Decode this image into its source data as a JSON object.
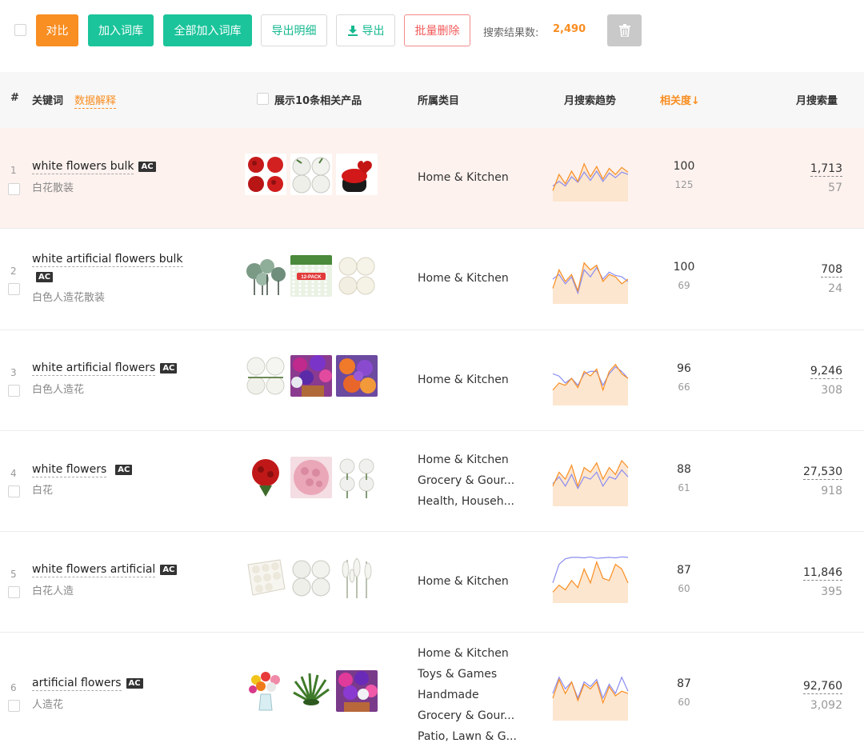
{
  "toolbar": {
    "compare_label": "对比",
    "add_to_lib_label": "加入词库",
    "add_all_to_lib_label": "全部加入词库",
    "export_detail_label": "导出明细",
    "export_label": "导出",
    "bulk_delete_label": "批量删除",
    "result_label": "搜索结果数:",
    "result_count": "2,490",
    "trash_icon": "trash-icon",
    "download_icon": "download-icon"
  },
  "header": {
    "index": "#",
    "keyword": "关键词",
    "data_explain": "数据解释",
    "show_products": "展示10条相关产品",
    "category": "所属类目",
    "trend": "月搜索趋势",
    "relevance": "相关度",
    "relevance_sort_icon": "arrow-down-icon",
    "volume": "月搜索量"
  },
  "colors": {
    "accent_orange": "#f98e22",
    "accent_green": "#1bc49b",
    "danger_red": "#f25a5a",
    "trend_orange": "#f98e22",
    "trend_blue": "#8a8cf0",
    "highlight_row": "#fdf2ee"
  },
  "rows": [
    {
      "index": "1",
      "keyword": "white flowers bulk",
      "badge": "AC",
      "translation": "白花散装",
      "categories": [
        "Home & Kitchen"
      ],
      "relevance": "100",
      "relevance_sub": "125",
      "volume": "1,713",
      "volume_sub": "57",
      "products": [
        "red-rose-bouquets-image",
        "white-rose-bouquets-image",
        "red-rose-heart-box-image"
      ],
      "trend_orange": [
        20,
        55,
        35,
        62,
        40,
        78,
        50,
        72,
        45,
        68,
        55,
        70,
        60
      ],
      "trend_blue": [
        30,
        40,
        30,
        50,
        38,
        60,
        42,
        62,
        40,
        58,
        48,
        60,
        55
      ]
    },
    {
      "index": "2",
      "keyword": "white artificial flowers bulk",
      "badge": "AC",
      "translation": "白色人造花散装",
      "categories": [
        "Home & Kitchen"
      ],
      "relevance": "100",
      "relevance_sub": "69",
      "volume": "708",
      "volume_sub": "24",
      "products": [
        "succulent-stems-image",
        "white-flower-garland-12-pack-image",
        "white-rose-balls-image"
      ],
      "trend_orange": [
        30,
        70,
        45,
        60,
        25,
        85,
        70,
        80,
        45,
        60,
        55,
        40,
        50
      ],
      "trend_blue": [
        50,
        60,
        40,
        55,
        20,
        70,
        55,
        75,
        50,
        65,
        58,
        55,
        45
      ]
    },
    {
      "index": "3",
      "keyword": "white artificial flowers",
      "badge": "AC",
      "translation": "白色人造花",
      "categories": [
        "Home & Kitchen"
      ],
      "relevance": "96",
      "relevance_sub": "66",
      "volume": "9,246",
      "volume_sub": "308",
      "products": [
        "white-rose-bushes-image",
        "purple-potted-flowers-image",
        "orange-purple-flowers-image"
      ],
      "trend_orange": [
        30,
        45,
        40,
        55,
        35,
        70,
        60,
        75,
        30,
        70,
        85,
        65,
        55
      ],
      "trend_blue": [
        65,
        60,
        45,
        55,
        40,
        65,
        70,
        70,
        40,
        65,
        80,
        70,
        55
      ]
    },
    {
      "index": "4",
      "keyword": "white flowers",
      "badge": "AC",
      "translation": "白花",
      "categories": [
        "Home & Kitchen",
        "Grocery & Gour...",
        "Health, Househ..."
      ],
      "relevance": "88",
      "relevance_sub": "61",
      "volume": "27,530",
      "volume_sub": "918",
      "products": [
        "red-rose-bouquet-image",
        "pink-rose-ball-image",
        "white-baby-breath-image"
      ],
      "trend_orange": [
        40,
        70,
        55,
        85,
        40,
        80,
        70,
        90,
        55,
        80,
        65,
        95,
        80
      ],
      "trend_blue": [
        45,
        60,
        40,
        65,
        35,
        60,
        55,
        70,
        40,
        60,
        55,
        75,
        60
      ]
    },
    {
      "index": "5",
      "keyword": "white flowers artificial",
      "badge": "AC",
      "translation": "白花人造",
      "categories": [
        "Home & Kitchen"
      ],
      "relevance": "87",
      "relevance_sub": "60",
      "volume": "11,846",
      "volume_sub": "395",
      "products": [
        "white-foam-roses-box-image",
        "white-rose-bouquets-image",
        "white-wisteria-stems-image"
      ],
      "trend_orange": [
        20,
        35,
        25,
        45,
        30,
        70,
        40,
        85,
        50,
        45,
        80,
        70,
        40
      ],
      "trend_blue": [
        40,
        80,
        92,
        95,
        95,
        94,
        96,
        93,
        94,
        95,
        94,
        96,
        95
      ]
    },
    {
      "index": "6",
      "keyword": "artificial flowers",
      "badge": "AC",
      "translation": "人造花",
      "categories": [
        "Home & Kitchen",
        "Toys & Games",
        "Handmade",
        "Grocery & Gour...",
        "Patio, Lawn & G..."
      ],
      "relevance": "87",
      "relevance_sub": "60",
      "volume": "92,760",
      "volume_sub": "3,092",
      "products": [
        "mixed-rose-vase-image",
        "green-grass-bush-image",
        "pink-purple-potted-flowers-image"
      ],
      "trend_orange": [
        45,
        85,
        55,
        80,
        40,
        75,
        65,
        80,
        35,
        70,
        50,
        60,
        55
      ],
      "trend_blue": [
        55,
        90,
        65,
        80,
        45,
        80,
        70,
        85,
        45,
        75,
        55,
        90,
        60
      ]
    }
  ]
}
